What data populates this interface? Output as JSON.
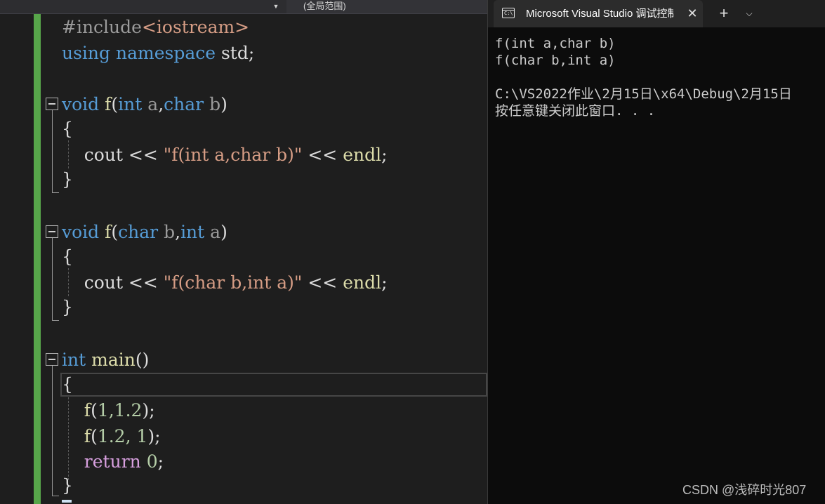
{
  "editor": {
    "scope_dropdown": "(全局范围)",
    "tokens": {
      "include_directive": "#include",
      "include_header": "<iostream>",
      "kw_using": "using",
      "kw_namespace": "namespace",
      "std_semicolon": " std;",
      "kw_void": "void",
      "fn_f": "f",
      "kw_int": "int",
      "kw_char": "char",
      "param_a": "a",
      "param_b": "b",
      "paren_open": "(",
      "paren_close": ")",
      "comma": ",",
      "brace_open": "{",
      "brace_close": "}",
      "cout": "cout",
      "shift_op": " << ",
      "str1": "\"f(int a,char b)\"",
      "str2": "\"f(char b,int a)\"",
      "endl": "endl",
      "semicolon": ";",
      "fn_main": "main",
      "empty_parens": "()",
      "call1_args": "1,1.2",
      "call2_args": "1.2, 1",
      "kw_return": "return",
      "zero": "0",
      "call_close": ");"
    }
  },
  "terminal": {
    "tab_title": "Microsoft Visual Studio 调试控制台",
    "tab_icon_text": "C:\\",
    "lines": [
      "f(int a,char b)",
      "f(char b,int a)",
      "",
      "C:\\VS2022作业\\2月15日\\x64\\Debug\\2月15日",
      "按任意键关闭此窗口. . ."
    ]
  },
  "watermark": "CSDN @浅碎时光807",
  "colors": {
    "keyword": "#569cd6",
    "function": "#dcdcaa",
    "string": "#d69d85",
    "return_keyword": "#d8a0df",
    "number": "#b5cea8",
    "change_bar": "#57a64a"
  },
  "icons": {
    "dropdown": "chevron-down-icon",
    "fold": "collapse-minus-icon",
    "tab_icon": "console-icon",
    "close": "close-icon",
    "new_tab": "plus-icon",
    "tab_dropdown": "chevron-down-icon"
  }
}
